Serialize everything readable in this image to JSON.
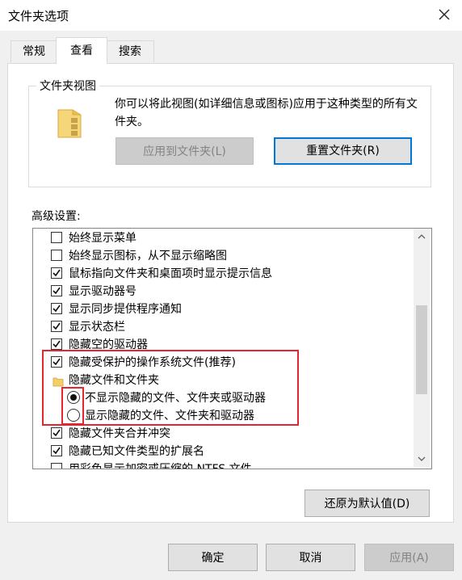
{
  "window": {
    "title": "文件夹选项"
  },
  "tabs": [
    {
      "label": "常规"
    },
    {
      "label": "查看"
    },
    {
      "label": "搜索"
    }
  ],
  "folder_views": {
    "legend": "文件夹视图",
    "description": "你可以将此视图(如详细信息或图标)应用于这种类型的所有文件夹。",
    "apply_button": "应用到文件夹(L)",
    "reset_button": "重置文件夹(R)"
  },
  "advanced": {
    "label": "高级设置:",
    "items": [
      {
        "kind": "checkbox",
        "label": "始终显示菜单",
        "checked": false
      },
      {
        "kind": "checkbox",
        "label": "始终显示图标，从不显示缩略图",
        "checked": false
      },
      {
        "kind": "checkbox",
        "label": "鼠标指向文件夹和桌面项时显示提示信息",
        "checked": true
      },
      {
        "kind": "checkbox",
        "label": "显示驱动器号",
        "checked": true
      },
      {
        "kind": "checkbox",
        "label": "显示同步提供程序通知",
        "checked": true
      },
      {
        "kind": "checkbox",
        "label": "显示状态栏",
        "checked": true
      },
      {
        "kind": "checkbox",
        "label": "隐藏空的驱动器",
        "checked": true
      },
      {
        "kind": "checkbox",
        "label": "隐藏受保护的操作系统文件(推荐)",
        "checked": true
      },
      {
        "kind": "folder",
        "label": "隐藏文件和文件夹"
      },
      {
        "kind": "radio",
        "label": "不显示隐藏的文件、文件夹或驱动器",
        "selected": true
      },
      {
        "kind": "radio",
        "label": "显示隐藏的文件、文件夹和驱动器",
        "selected": false
      },
      {
        "kind": "checkbox",
        "label": "隐藏文件夹合并冲突",
        "checked": true
      },
      {
        "kind": "checkbox",
        "label": "隐藏已知文件类型的扩展名",
        "checked": true
      },
      {
        "kind": "checkbox",
        "label": "用彩色显示加密或压缩的 NTFS 文件",
        "checked": false
      }
    ]
  },
  "restore_defaults_button": "还原为默认值(D)",
  "footer": {
    "ok": "确定",
    "cancel": "取消",
    "apply": "应用(A)"
  },
  "colors": {
    "focus_border": "#0078d7",
    "highlight": "#e3262f"
  }
}
